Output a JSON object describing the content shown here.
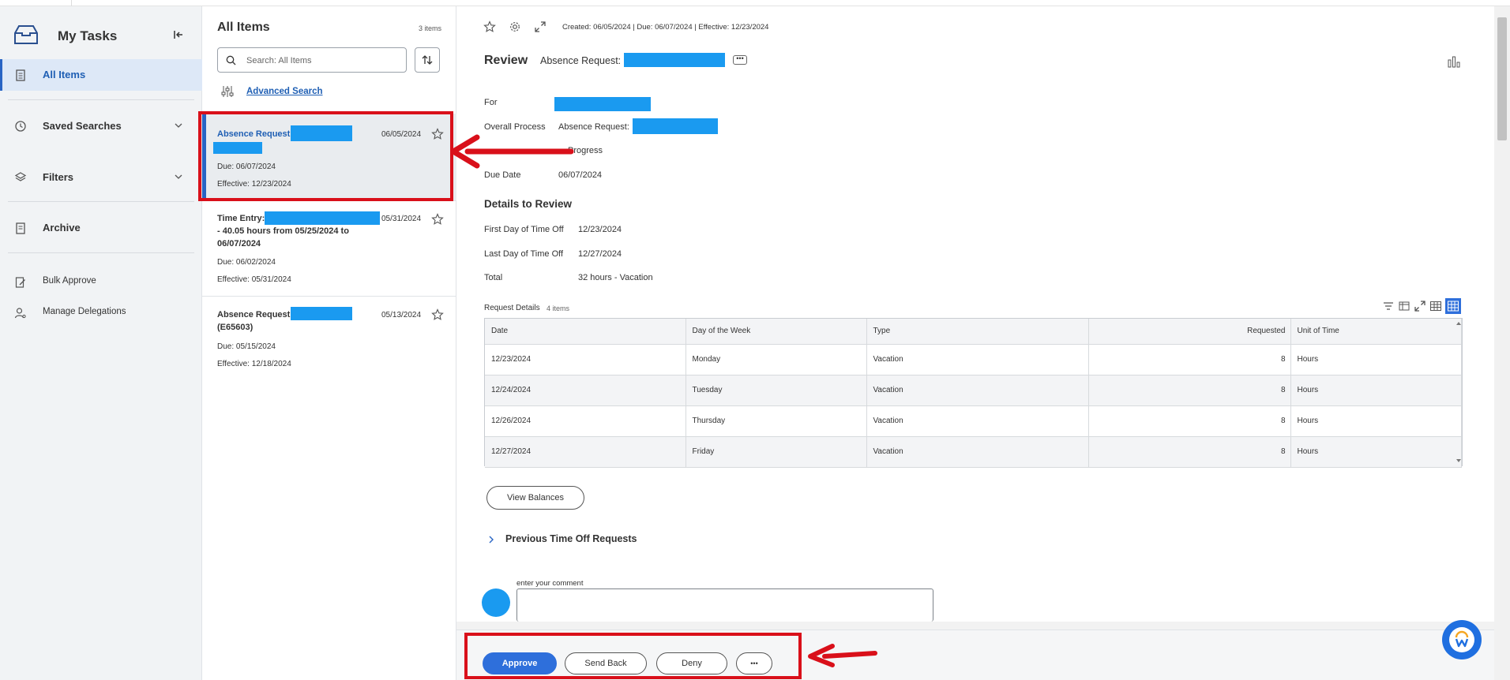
{
  "sidebar": {
    "title": "My Tasks",
    "items": [
      {
        "label": "All Items"
      },
      {
        "label": "Saved Searches"
      },
      {
        "label": "Filters"
      },
      {
        "label": "Archive"
      },
      {
        "label": "Bulk Approve"
      },
      {
        "label": "Manage Delegations"
      }
    ]
  },
  "list": {
    "title": "All Items",
    "count": "3 items",
    "search_placeholder": "Search: All Items",
    "advanced_search": "Advanced Search",
    "cards": [
      {
        "title": "Absence Request:",
        "date": "06/05/2024",
        "due": "Due: 06/07/2024",
        "effective": "Effective: 12/23/2024"
      },
      {
        "title_line1": "Time Entry:",
        "title_line2": "- 40.05 hours from 05/25/2024 to",
        "title_line3": "06/07/2024",
        "date": "05/31/2024",
        "due": "Due: 06/02/2024",
        "effective": "Effective: 05/31/2024"
      },
      {
        "title_line1": "Absence Request:",
        "title_line2": "(E65603)",
        "date": "05/13/2024",
        "due": "Due: 05/15/2024",
        "effective": "Effective: 12/18/2024"
      }
    ]
  },
  "main": {
    "meta": "Created: 06/05/2024 | Due: 06/07/2024 | Effective: 12/23/2024",
    "heading": "Review",
    "subheading": "Absence Request:",
    "fields": {
      "for_label": "For",
      "overall_label": "Overall Process",
      "overall_value": "Absence Request:",
      "status_value": "Progress",
      "due_label": "Due Date",
      "due_value": "06/07/2024"
    },
    "details_title": "Details to Review",
    "details": [
      {
        "label": "First Day of Time Off",
        "value": "12/23/2024"
      },
      {
        "label": "Last Day of Time Off",
        "value": "12/27/2024"
      },
      {
        "label": "Total",
        "value": "32 hours - Vacation"
      }
    ],
    "request_details_label": "Request Details",
    "request_details_count": "4 items",
    "table": {
      "headers": [
        "Date",
        "Day of the Week",
        "Type",
        "Requested",
        "Unit of Time"
      ],
      "rows": [
        [
          "12/23/2024",
          "Monday",
          "Vacation",
          "8",
          "Hours"
        ],
        [
          "12/24/2024",
          "Tuesday",
          "Vacation",
          "8",
          "Hours"
        ],
        [
          "12/26/2024",
          "Thursday",
          "Vacation",
          "8",
          "Hours"
        ],
        [
          "12/27/2024",
          "Friday",
          "Vacation",
          "8",
          "Hours"
        ]
      ]
    },
    "view_balances": "View Balances",
    "previous_requests": "Previous Time Off Requests",
    "comment_label": "enter your comment",
    "actions": {
      "approve": "Approve",
      "send_back": "Send Back",
      "deny": "Deny",
      "more": "•••"
    },
    "more_dots": "•••"
  },
  "colors": {
    "accent": "#2e6fdb",
    "annotation_red": "#d9101a",
    "redaction": "#1a9af0"
  }
}
